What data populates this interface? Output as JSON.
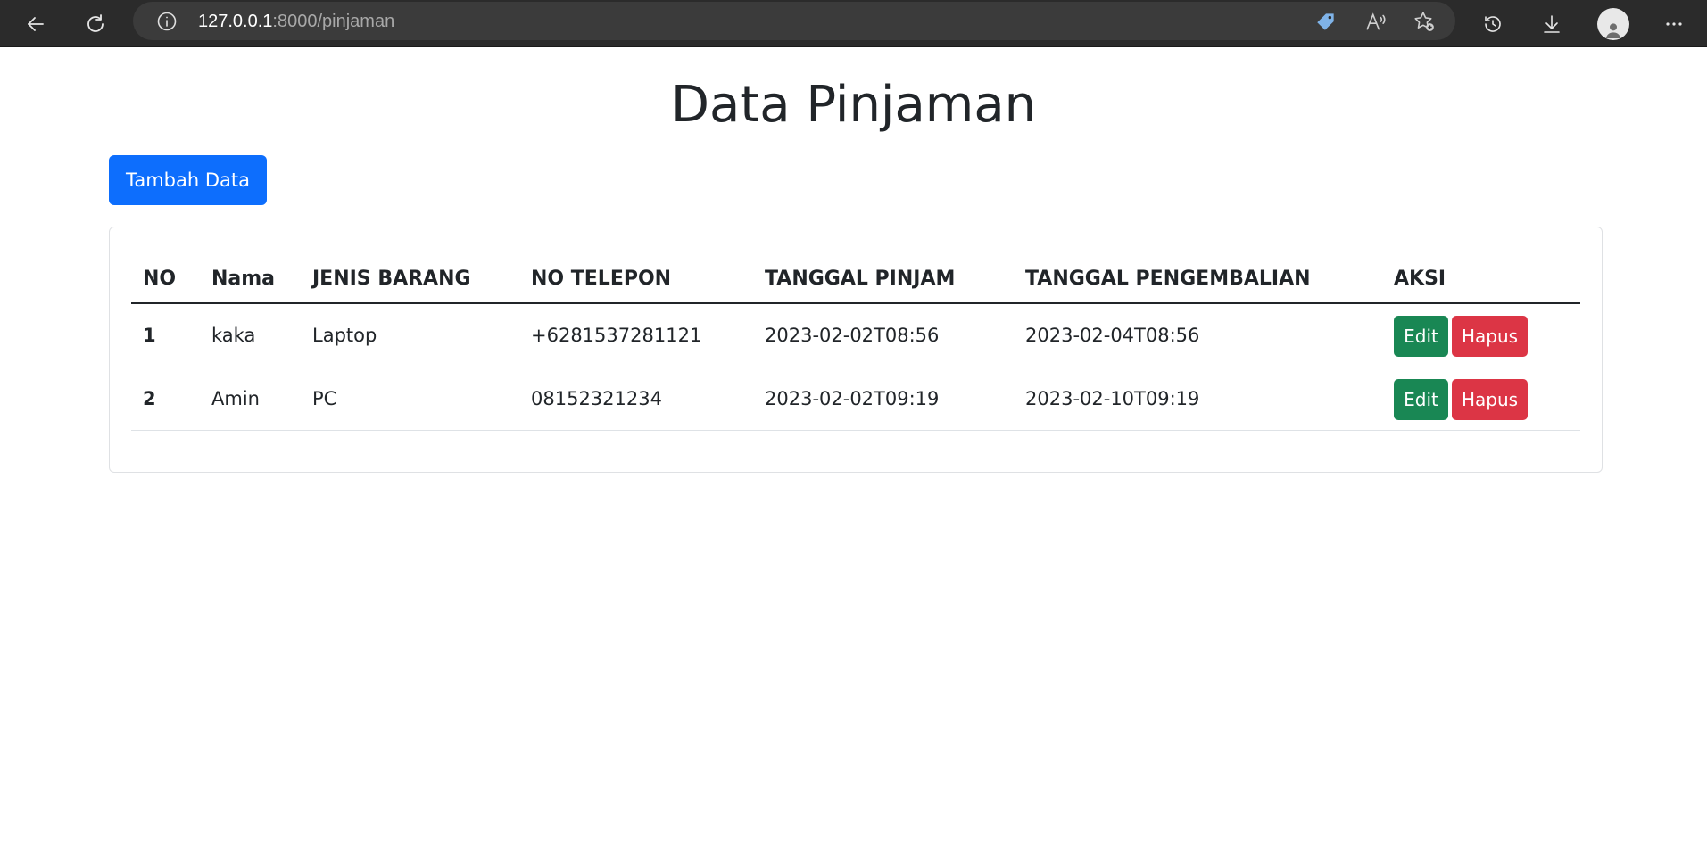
{
  "browser": {
    "url_host": "127.0.0.1",
    "url_path": ":8000/pinjaman"
  },
  "page": {
    "title": "Data Pinjaman",
    "add_button_label": "Tambah Data"
  },
  "table": {
    "headers": [
      "NO",
      "Nama",
      "JENIS BARANG",
      "NO TELEPON",
      "TANGGAL PINJAM",
      "TANGGAL PENGEMBALIAN",
      "AKSI"
    ],
    "rows": [
      {
        "no": "1",
        "nama": "kaka",
        "jenis_barang": "Laptop",
        "no_telepon": "+6281537281121",
        "tanggal_pinjam": "2023-02-02T08:56",
        "tanggal_pengembalian": "2023-02-04T08:56",
        "edit_label": "Edit",
        "delete_label": "Hapus"
      },
      {
        "no": "2",
        "nama": "Amin",
        "jenis_barang": "PC",
        "no_telepon": "08152321234",
        "tanggal_pinjam": "2023-02-02T09:19",
        "tanggal_pengembalian": "2023-02-10T09:19",
        "edit_label": "Edit",
        "delete_label": "Hapus"
      }
    ]
  },
  "colors": {
    "primary": "#0d6efd",
    "success": "#198754",
    "danger": "#dc3545",
    "chrome": "#2b2b2b"
  }
}
